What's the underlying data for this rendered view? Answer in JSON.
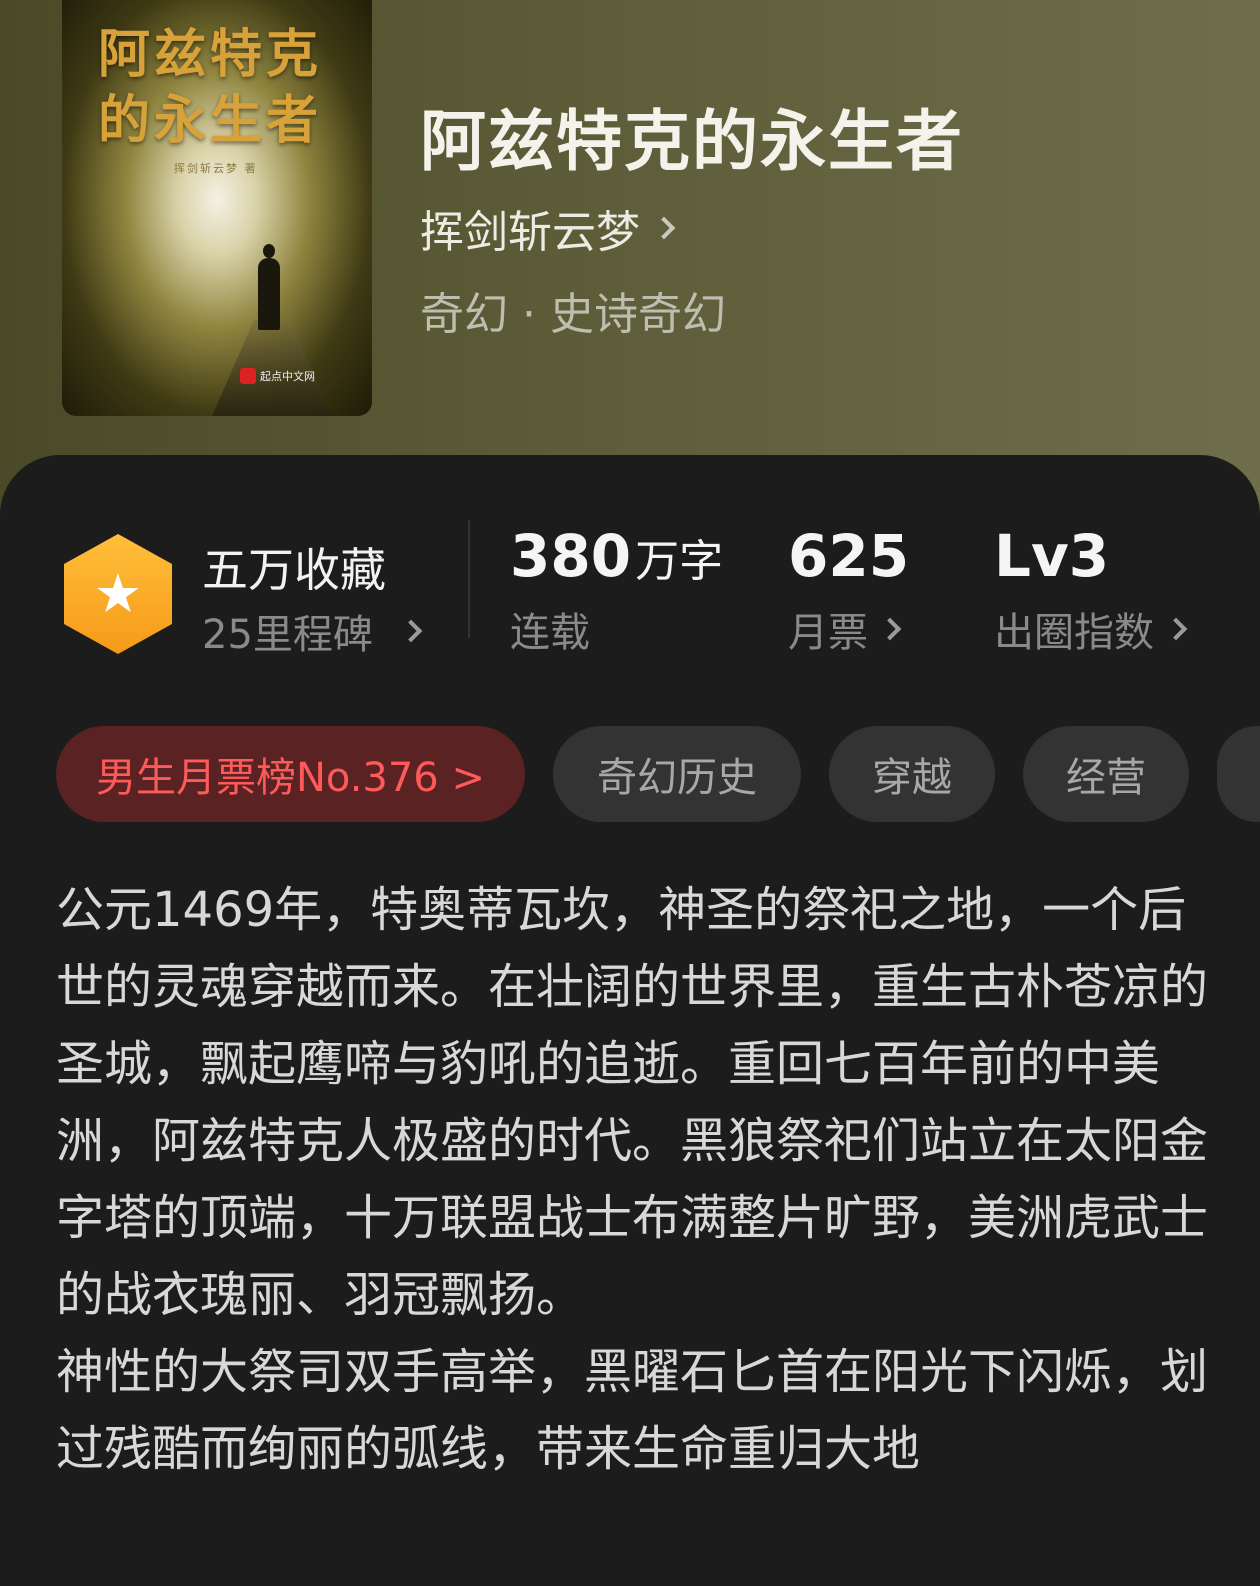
{
  "book": {
    "title": "阿兹特克的永生者",
    "author": "挥剑斩云梦",
    "category": "奇幻 · 史诗奇幻",
    "cover": {
      "title_line1": "阿兹特克",
      "title_line2": "的永生者",
      "author_small": "挥剑斩云梦 著",
      "publisher": "起点中文网"
    }
  },
  "stats": {
    "collect": {
      "title": "五万收藏",
      "milestone": "25里程碑"
    },
    "words": {
      "value": "380",
      "unit": "万字",
      "label": "连载"
    },
    "tickets": {
      "value": "625",
      "label": "月票"
    },
    "index": {
      "value": "Lv3",
      "label": "出圈指数"
    }
  },
  "tags": [
    {
      "label": "男生月票榜No.376 >",
      "type": "rank"
    },
    {
      "label": "奇幻历史"
    },
    {
      "label": "穿越"
    },
    {
      "label": "经营"
    }
  ],
  "description": "公元1469年，特奥蒂瓦坎，神圣的祭祀之地，一个后世的灵魂穿越而来。在壮阔的世界里，重生古朴苍凉的圣城，飘起鹰啼与豹吼的追逝。重回七百年前的中美洲，阿兹特克人极盛的时代。黑狼祭祀们站立在太阳金字塔的顶端，十万联盟战士布满整片旷野，美洲虎武士的战衣瑰丽、羽冠飘扬。\n神性的大祭司双手高举，黑曜石匕首在阳光下闪烁，划过残酷而绚丽的弧线，带来生命重归大地",
  "colors": {
    "header_bg": "#5c5c38",
    "sheet_bg": "#1c1c1c",
    "badge": "#f5a623",
    "rank_text": "#ff5a5a",
    "rank_bg": "#5a2222"
  }
}
